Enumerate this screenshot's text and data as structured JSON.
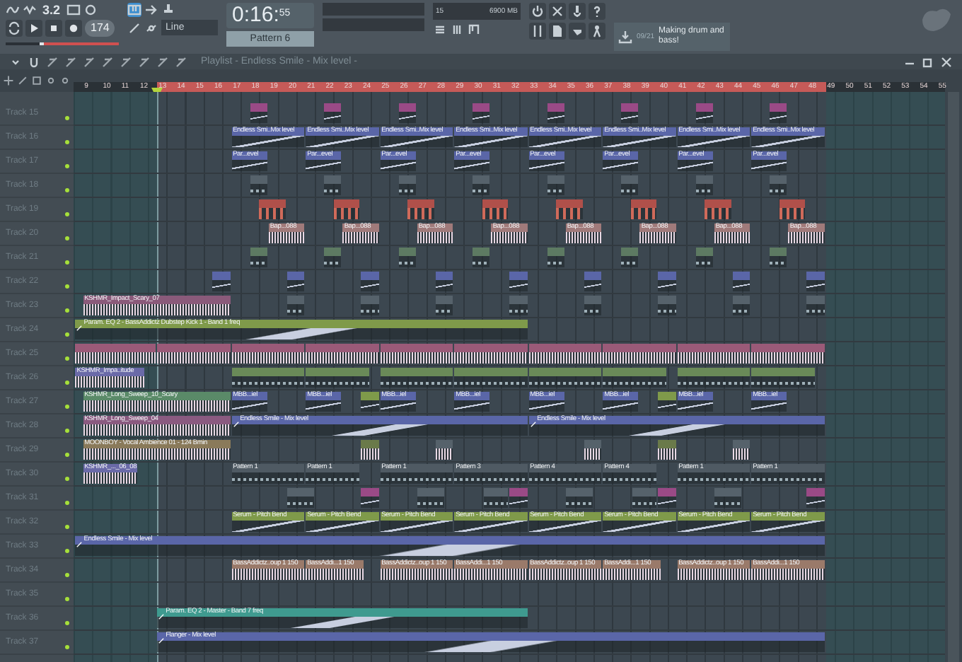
{
  "toolbar": {
    "version": "3.2",
    "tempo": "174",
    "volume": {
      "level": 0.3
    },
    "time": "0:16:",
    "time_sub": "55",
    "pattern": "Pattern 6",
    "snap": "Line",
    "cpu": "15",
    "memory": "6900 MB",
    "hint_counter": "09/21",
    "hint": "Making drum and bass!"
  },
  "playlist": {
    "title": "Playlist - Endless Smile - Mix level -",
    "ruler": [
      "9",
      "10",
      "11",
      "12",
      "13",
      "14",
      "15",
      "16",
      "17",
      "18",
      "19",
      "20",
      "21",
      "22",
      "23",
      "24",
      "25",
      "26",
      "27",
      "28",
      "29",
      "30",
      "31",
      "32",
      "33",
      "34",
      "35",
      "36",
      "37",
      "38",
      "39",
      "40",
      "41",
      "42",
      "43",
      "44",
      "45",
      "46",
      "47",
      "48",
      "49",
      "50",
      "51",
      "52",
      "53",
      "54",
      "55"
    ],
    "tracks": [
      {
        "name": "Track 15",
        "on": true,
        "clips": [
          {
            "kind": "automation",
            "color": "#9a4a86"
          },
          {
            "kind": "automation",
            "color": "#9a4a86"
          },
          {
            "kind": "automation",
            "color": "#9a4a86"
          },
          {
            "kind": "automation",
            "color": "#9a4a86"
          },
          {
            "kind": "automation",
            "color": "#9a4a86"
          },
          {
            "kind": "automation",
            "color": "#9a4a86"
          },
          {
            "kind": "automation",
            "color": "#9a4a86"
          },
          {
            "kind": "automation",
            "color": "#9a4a86"
          }
        ]
      },
      {
        "name": "Track 16",
        "on": true,
        "clips": [
          {
            "kind": "automation",
            "color": "#5a66a8",
            "label": "Endless Smi..Mix level"
          },
          {
            "kind": "automation",
            "color": "#5a66a8",
            "label": "Endless Smi..Mix level"
          },
          {
            "kind": "automation",
            "color": "#5a66a8",
            "label": "Endless Smi..Mix level"
          },
          {
            "kind": "automation",
            "color": "#5a66a8",
            "label": "Endless Smi..Mix level"
          },
          {
            "kind": "automation",
            "color": "#5a66a8",
            "label": "Endless Smi..Mix level"
          },
          {
            "kind": "automation",
            "color": "#5a66a8",
            "label": "Endless Smi..Mix level"
          },
          {
            "kind": "automation",
            "color": "#5a66a8",
            "label": "Endless Smi..Mix level"
          },
          {
            "kind": "automation",
            "color": "#5a66a8",
            "label": "Endless Smi..Mix level"
          }
        ]
      },
      {
        "name": "Track 17",
        "on": true,
        "clips": [
          {
            "kind": "automation",
            "color": "#5a66a8",
            "label": "Par...evel"
          },
          {
            "kind": "automation",
            "color": "#5a66a8",
            "label": "Par...evel"
          },
          {
            "kind": "automation",
            "color": "#5a66a8",
            "label": "Par...evel"
          },
          {
            "kind": "automation",
            "color": "#5a66a8",
            "label": "Par...evel"
          },
          {
            "kind": "automation",
            "color": "#5a66a8",
            "label": "Par...evel"
          },
          {
            "kind": "automation",
            "color": "#5a66a8",
            "label": "Par...evel"
          },
          {
            "kind": "automation",
            "color": "#5a66a8",
            "label": "Par...evel"
          },
          {
            "kind": "automation",
            "color": "#5a66a8",
            "label": "Par...evel"
          }
        ]
      },
      {
        "name": "Track 18",
        "on": true,
        "clips": [
          {
            "kind": "pattern",
            "color": "#56626b"
          },
          {
            "kind": "pattern",
            "color": "#56626b"
          },
          {
            "kind": "pattern",
            "color": "#56626b"
          },
          {
            "kind": "pattern",
            "color": "#56626b"
          },
          {
            "kind": "pattern",
            "color": "#56626b"
          },
          {
            "kind": "pattern",
            "color": "#56626b"
          },
          {
            "kind": "pattern",
            "color": "#56626b"
          },
          {
            "kind": "pattern",
            "color": "#56626b"
          }
        ]
      },
      {
        "name": "Track 19",
        "on": true,
        "clips": [
          {
            "kind": "notes",
            "color": "#b0504a"
          },
          {
            "kind": "notes",
            "color": "#b0504a"
          },
          {
            "kind": "notes",
            "color": "#b0504a"
          },
          {
            "kind": "notes",
            "color": "#b0504a"
          },
          {
            "kind": "notes",
            "color": "#b0504a"
          },
          {
            "kind": "notes",
            "color": "#b0504a"
          },
          {
            "kind": "notes",
            "color": "#b0504a"
          },
          {
            "kind": "notes",
            "color": "#b0504a"
          }
        ]
      },
      {
        "name": "Track 20",
        "on": true,
        "clips": [
          {
            "kind": "audio",
            "color": "#a07a7a",
            "label": "Bap...088"
          },
          {
            "kind": "audio",
            "color": "#a07a7a",
            "label": "Bap...088"
          },
          {
            "kind": "audio",
            "color": "#a07a7a",
            "label": "Bap...088"
          },
          {
            "kind": "audio",
            "color": "#a07a7a",
            "label": "Bap...088"
          },
          {
            "kind": "audio",
            "color": "#a07a7a",
            "label": "Bap...088"
          },
          {
            "kind": "audio",
            "color": "#a07a7a",
            "label": "Bap...088"
          },
          {
            "kind": "audio",
            "color": "#a07a7a",
            "label": "Bap...088"
          },
          {
            "kind": "audio",
            "color": "#a07a7a",
            "label": "Bap...088"
          }
        ]
      },
      {
        "name": "Track 21",
        "on": true,
        "clips": [
          {
            "kind": "pattern",
            "color": "#5d7a62"
          },
          {
            "kind": "pattern",
            "color": "#5d7a62"
          },
          {
            "kind": "pattern",
            "color": "#5d7a62"
          },
          {
            "kind": "pattern",
            "color": "#5d7a62"
          },
          {
            "kind": "pattern",
            "color": "#5d7a62"
          },
          {
            "kind": "pattern",
            "color": "#5d7a62"
          },
          {
            "kind": "pattern",
            "color": "#5d7a62"
          },
          {
            "kind": "pattern",
            "color": "#5d7a62"
          }
        ]
      },
      {
        "name": "Track 22",
        "on": true,
        "clips": [
          {
            "kind": "automation",
            "color": "#5a66a8"
          },
          {
            "kind": "automation",
            "color": "#5a66a8"
          },
          {
            "kind": "automation",
            "color": "#5a66a8"
          },
          {
            "kind": "automation",
            "color": "#5a66a8"
          },
          {
            "kind": "automation",
            "color": "#5a66a8"
          },
          {
            "kind": "automation",
            "color": "#5a66a8"
          },
          {
            "kind": "automation",
            "color": "#5a66a8"
          },
          {
            "kind": "automation",
            "color": "#5a66a8"
          },
          {
            "kind": "automation",
            "color": "#5a66a8"
          }
        ]
      },
      {
        "name": "Track 23",
        "on": true,
        "clips": [
          {
            "kind": "audio",
            "color": "#8a5a7a",
            "label": "KSHMR_Impact_Scary_07"
          },
          {
            "kind": "pattern",
            "color": "#56626b"
          },
          {
            "kind": "pattern",
            "color": "#56626b"
          },
          {
            "kind": "pattern",
            "color": "#56626b"
          },
          {
            "kind": "pattern",
            "color": "#56626b"
          },
          {
            "kind": "pattern",
            "color": "#56626b"
          },
          {
            "kind": "pattern",
            "color": "#56626b"
          },
          {
            "kind": "pattern",
            "color": "#56626b"
          },
          {
            "kind": "pattern",
            "color": "#56626b"
          }
        ]
      },
      {
        "name": "Track 24",
        "on": true,
        "clips": [
          {
            "kind": "automation",
            "color": "#7f9a4a",
            "label": "Param. EQ 2 - BassAddictz Dubstep Kick 1 - Band 1 freq"
          }
        ]
      },
      {
        "name": "Track 25",
        "on": true,
        "clips": [
          {
            "kind": "audio",
            "color": "#9a5a78"
          },
          {
            "kind": "audio",
            "color": "#9a5a78"
          },
          {
            "kind": "audio",
            "color": "#9a5a78"
          },
          {
            "kind": "audio",
            "color": "#9a5a78"
          },
          {
            "kind": "audio",
            "color": "#9a5a78"
          },
          {
            "kind": "audio",
            "color": "#9a5a78"
          },
          {
            "kind": "audio",
            "color": "#9a5a78"
          },
          {
            "kind": "audio",
            "color": "#9a5a78"
          },
          {
            "kind": "audio",
            "color": "#9a5a78"
          },
          {
            "kind": "audio",
            "color": "#9a5a78"
          }
        ]
      },
      {
        "name": "Track 26",
        "on": true,
        "clips": [
          {
            "kind": "audio",
            "color": "#6a6aa8",
            "label": "KSHMR_Impa..itude"
          },
          {
            "kind": "pattern",
            "color": "#6a8a58"
          },
          {
            "kind": "pattern",
            "color": "#6a8a58"
          },
          {
            "kind": "pattern",
            "color": "#6a8a58"
          },
          {
            "kind": "pattern",
            "color": "#6a8a58"
          },
          {
            "kind": "pattern",
            "color": "#6a8a58"
          },
          {
            "kind": "pattern",
            "color": "#6a8a58"
          },
          {
            "kind": "pattern",
            "color": "#6a8a58"
          },
          {
            "kind": "pattern",
            "color": "#6a8a58"
          }
        ]
      },
      {
        "name": "Track 27",
        "on": true,
        "clips": [
          {
            "kind": "audio",
            "color": "#5a8a68",
            "label": "KSHMR_Long_Sweep_10_Scary"
          },
          {
            "kind": "automation",
            "color": "#5a66a8",
            "label": "MBB...iel"
          },
          {
            "kind": "automation",
            "color": "#5a66a8",
            "label": "MBB...iel"
          },
          {
            "kind": "automation",
            "color": "#7f9a4a"
          },
          {
            "kind": "automation",
            "color": "#5a66a8",
            "label": "MBB...iel"
          },
          {
            "kind": "automation",
            "color": "#5a66a8",
            "label": "MBB...iel"
          },
          {
            "kind": "automation",
            "color": "#5a66a8",
            "label": "MBB...iel"
          },
          {
            "kind": "automation",
            "color": "#5a66a8",
            "label": "MBB...iel"
          },
          {
            "kind": "automation",
            "color": "#7f9a4a"
          },
          {
            "kind": "automation",
            "color": "#5a66a8",
            "label": "MBB...iel"
          },
          {
            "kind": "automation",
            "color": "#5a66a8",
            "label": "MBB...iel"
          }
        ]
      },
      {
        "name": "Track 28",
        "on": true,
        "clips": [
          {
            "kind": "audio",
            "color": "#8a5a80",
            "label": "KSHMR_Long_Sweep_04"
          },
          {
            "kind": "automation",
            "color": "#5a66a8",
            "label": "Endless Smile - Mix level"
          },
          {
            "kind": "automation",
            "color": "#5a66a8",
            "label": "Endless Smile - Mix level"
          }
        ]
      },
      {
        "name": "Track 29",
        "on": true,
        "clips": [
          {
            "kind": "audio",
            "color": "#8a7a5a",
            "label": "MOONBOY - Vocal Ambience 01 - 124 Bmin"
          },
          {
            "kind": "audio",
            "color": "#6a7a4a"
          },
          {
            "kind": "audio",
            "color": "#56626b"
          },
          {
            "kind": "audio",
            "color": "#56626b"
          },
          {
            "kind": "audio",
            "color": "#6a7a4a"
          },
          {
            "kind": "audio",
            "color": "#56626b"
          }
        ]
      },
      {
        "name": "Track 30",
        "on": true,
        "clips": [
          {
            "kind": "audio",
            "color": "#6a6aa8",
            "label": "KSHMR_..._06_08"
          },
          {
            "kind": "pattern",
            "color": "#4f5a63",
            "label": "Pattern 1"
          },
          {
            "kind": "pattern",
            "color": "#4f5a63",
            "label": "Pattern 1"
          },
          {
            "kind": "pattern",
            "color": "#4f5a63",
            "label": "Pattern 1"
          },
          {
            "kind": "pattern",
            "color": "#4f5a63",
            "label": "Pattern 3"
          },
          {
            "kind": "pattern",
            "color": "#4f5a63",
            "label": "Pattern 4"
          },
          {
            "kind": "pattern",
            "color": "#4f5a63",
            "label": "Pattern 4"
          },
          {
            "kind": "pattern",
            "color": "#4f5a63",
            "label": "Pattern 1"
          },
          {
            "kind": "pattern",
            "color": "#4f5a63",
            "label": "Pattern 1"
          }
        ]
      },
      {
        "name": "Track 31",
        "on": true,
        "clips": [
          {
            "kind": "pattern",
            "color": "#56626b"
          },
          {
            "kind": "automation",
            "color": "#9a4a86"
          },
          {
            "kind": "pattern",
            "color": "#56626b"
          },
          {
            "kind": "pattern",
            "color": "#56626b"
          },
          {
            "kind": "automation",
            "color": "#9a4a86"
          },
          {
            "kind": "pattern",
            "color": "#56626b"
          },
          {
            "kind": "pattern",
            "color": "#56626b"
          },
          {
            "kind": "automation",
            "color": "#9a4a86"
          },
          {
            "kind": "pattern",
            "color": "#56626b"
          },
          {
            "kind": "automation",
            "color": "#9a4a86"
          }
        ]
      },
      {
        "name": "Track 32",
        "on": true,
        "clips": [
          {
            "kind": "automation",
            "color": "#7f9a4a",
            "label": "Serum - Pitch Bend"
          },
          {
            "kind": "automation",
            "color": "#7f9a4a",
            "label": "Serum - Pitch Bend"
          },
          {
            "kind": "automation",
            "color": "#7f9a4a",
            "label": "Serum - Pitch Bend"
          },
          {
            "kind": "automation",
            "color": "#7f9a4a",
            "label": "Serum - Pitch Bend"
          },
          {
            "kind": "automation",
            "color": "#7f9a4a",
            "label": "Serum - Pitch Bend"
          },
          {
            "kind": "automation",
            "color": "#7f9a4a",
            "label": "Serum - Pitch Bend"
          },
          {
            "kind": "automation",
            "color": "#7f9a4a",
            "label": "Serum - Pitch Bend"
          },
          {
            "kind": "automation",
            "color": "#7f9a4a",
            "label": "Serum - Pitch Bend"
          }
        ]
      },
      {
        "name": "Track 33",
        "on": true,
        "clips": [
          {
            "kind": "automation",
            "color": "#5a66a8",
            "label": "Endless Smile - Mix level"
          }
        ]
      },
      {
        "name": "Track 34",
        "on": true,
        "clips": [
          {
            "kind": "audio",
            "color": "#9a7a6a",
            "label": "BassAddictz..oup 1 150"
          },
          {
            "kind": "audio",
            "color": "#9a7a6a",
            "label": "BassAddi...1 150"
          },
          {
            "kind": "audio",
            "color": "#9a7a6a",
            "label": "BassAddictz..oup 1 150"
          },
          {
            "kind": "audio",
            "color": "#9a7a6a",
            "label": "BassAddi...1 150"
          },
          {
            "kind": "audio",
            "color": "#9a7a6a",
            "label": "BassAddictz..oup 1 150"
          },
          {
            "kind": "audio",
            "color": "#9a7a6a",
            "label": "BassAddi...1 150"
          },
          {
            "kind": "audio",
            "color": "#9a7a6a",
            "label": "BassAddictz..oup 1 150"
          },
          {
            "kind": "audio",
            "color": "#9a7a6a",
            "label": "BassAddi...1 150"
          }
        ]
      },
      {
        "name": "Track 35",
        "on": true
      },
      {
        "name": "Track 36",
        "on": true,
        "clips": [
          {
            "kind": "automation",
            "color": "#3f9a8f",
            "label": "Param. EQ 2 - Master - Band 7 freq"
          }
        ]
      },
      {
        "name": "Track 37",
        "on": true,
        "clips": [
          {
            "kind": "automation",
            "color": "#5a66a8",
            "label": "Flanger - Mix level"
          }
        ]
      }
    ]
  }
}
